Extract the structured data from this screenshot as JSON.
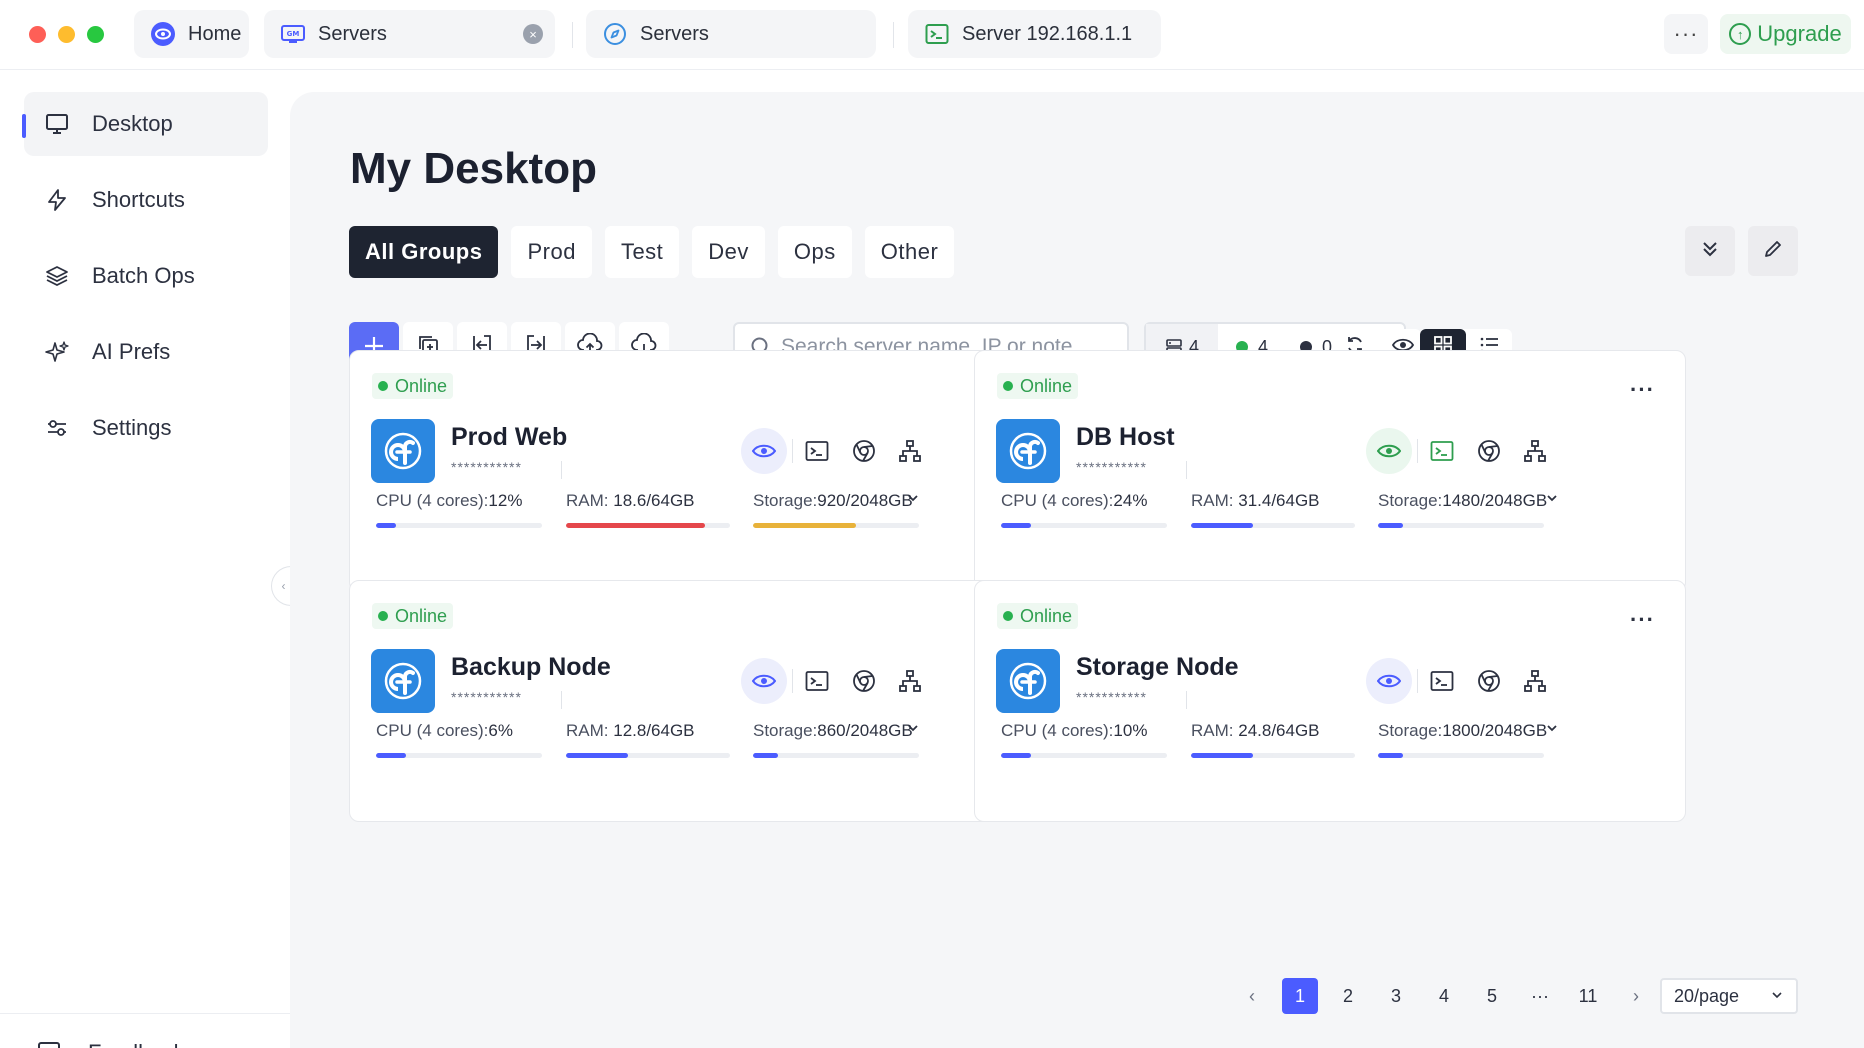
{
  "window": {
    "tabs": [
      {
        "label": "Home",
        "icon": "eye-logo-icon"
      },
      {
        "label": "Servers",
        "icon": "gm-server-icon",
        "closable": true
      },
      {
        "label": "Servers",
        "icon": "compass-icon"
      },
      {
        "label": "Server 192.168.1.1",
        "icon": "terminal-icon"
      }
    ],
    "more_label": "···",
    "upgrade_label": "Upgrade"
  },
  "sidebar": {
    "items": [
      {
        "label": "Desktop",
        "icon": "monitor-icon",
        "active": true
      },
      {
        "label": "Shortcuts",
        "icon": "lightning-icon"
      },
      {
        "label": "Batch Ops",
        "icon": "layers-icon"
      },
      {
        "label": "AI Prefs",
        "icon": "sparkle-icon"
      },
      {
        "label": "Settings",
        "icon": "sliders-icon"
      }
    ],
    "feedback_label": "Feedback"
  },
  "main": {
    "title": "My Desktop",
    "groups": [
      "All Groups",
      "Prod",
      "Test",
      "Dev",
      "Ops",
      "Other"
    ],
    "active_group": "All Groups",
    "search": {
      "placeholder": "Search server name, IP or note",
      "value": ""
    },
    "stats": {
      "total": "4",
      "online": "4",
      "offline": "0"
    },
    "colors": {
      "accent": "#4b5cff",
      "online": "#28b150",
      "dark": "#1e2431",
      "ram_high": "#e5474b",
      "storage_warn": "#e8b23a"
    }
  },
  "servers": [
    {
      "status": "Online",
      "name": "Prod Web",
      "mask": "***********",
      "cpu_label": "CPU (4 cores):",
      "cpu_value": "12%",
      "cpu_frac": 0.12,
      "cpu_color": "#4b5cff",
      "ram_label": "RAM:",
      "ram_value": "18.6/64GB",
      "ram_frac": 0.85,
      "ram_color": "#e5474b",
      "storage_label": "Storage:",
      "storage_value": "920/2048GB",
      "storage_frac": 0.62,
      "storage_color": "#e8b23a",
      "eye_green": false,
      "terminal_green": false,
      "pinned": true
    },
    {
      "status": "Online",
      "name": "DB Host",
      "mask": "***********",
      "cpu_label": "CPU (4 cores):",
      "cpu_value": "24%",
      "cpu_frac": 0.18,
      "cpu_color": "#4b5cff",
      "ram_label": "RAM:",
      "ram_value": "31.4/64GB",
      "ram_frac": 0.38,
      "ram_color": "#4b5cff",
      "storage_label": "Storage:",
      "storage_value": "1480/2048GB",
      "storage_frac": 0.15,
      "storage_color": "#4b5cff",
      "eye_green": true,
      "terminal_green": true,
      "pinned": false
    },
    {
      "status": "Online",
      "name": "Backup Node",
      "mask": "***********",
      "cpu_label": "CPU (4 cores):",
      "cpu_value": "6%",
      "cpu_frac": 0.18,
      "cpu_color": "#4b5cff",
      "ram_label": "RAM:",
      "ram_value": "12.8/64GB",
      "ram_frac": 0.38,
      "ram_color": "#4b5cff",
      "storage_label": "Storage:",
      "storage_value": "860/2048GB",
      "storage_frac": 0.15,
      "storage_color": "#4b5cff",
      "eye_green": false,
      "terminal_green": false,
      "pinned": false
    },
    {
      "status": "Online",
      "name": "Storage Node",
      "mask": "***********",
      "cpu_label": "CPU (4 cores):",
      "cpu_value": "10%",
      "cpu_frac": 0.18,
      "cpu_color": "#4b5cff",
      "ram_label": "RAM:",
      "ram_value": "24.8/64GB",
      "ram_frac": 0.38,
      "ram_color": "#4b5cff",
      "storage_label": "Storage:",
      "storage_value": "1800/2048GB",
      "storage_frac": 0.15,
      "storage_color": "#4b5cff",
      "eye_green": false,
      "terminal_green": false,
      "pinned": false
    }
  ],
  "pagination": {
    "prev": "‹",
    "pages": [
      "1",
      "2",
      "3",
      "4",
      "5"
    ],
    "ellipsis": "···",
    "last": "11",
    "next": "›",
    "current": "1",
    "page_size": "20/page"
  }
}
